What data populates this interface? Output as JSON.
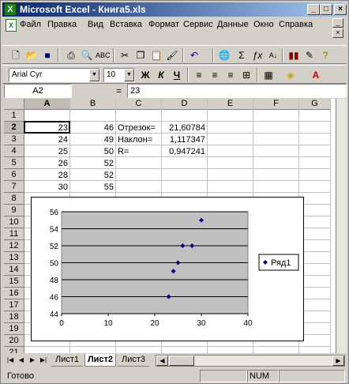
{
  "window": {
    "title": "Microsoft Excel - Книга5.xls",
    "app_icon": "excel-icon",
    "controls": [
      "_",
      "□",
      "×"
    ]
  },
  "menu": {
    "items": [
      "Файл",
      "Правка",
      "Вид",
      "Вставка",
      "Формат",
      "Сервис",
      "Данные",
      "Окно",
      "Справка"
    ],
    "doc_controls": [
      "_",
      "×"
    ]
  },
  "toolbar_standard": {
    "icons": [
      "new-icon",
      "open-icon",
      "save-icon",
      "print-icon",
      "print-preview-icon",
      "spelling-icon",
      "cut-icon",
      "copy-icon",
      "paste-icon",
      "format-painter-icon",
      "undo-icon",
      "hyperlink-icon",
      "autosum-icon",
      "function-icon",
      "sort-icon",
      "chart-wizard-icon",
      "drawing-icon",
      "help-icon"
    ]
  },
  "toolbar_format": {
    "font_name": "Arial Cyr",
    "font_size": "10",
    "bold": "Ж",
    "italic": "К",
    "underline": "Ч"
  },
  "formula_bar": {
    "name_box": "A2",
    "equals": "=",
    "value": "23"
  },
  "columns": [
    "A",
    "B",
    "C",
    "D",
    "E",
    "F",
    "G"
  ],
  "rows": [
    "1",
    "2",
    "3",
    "4",
    "5",
    "6",
    "7",
    "8",
    "9",
    "10",
    "11",
    "12",
    "13",
    "14",
    "15",
    "16",
    "17",
    "18",
    "19",
    "20",
    "21"
  ],
  "cells": {
    "A2": "23",
    "A3": "24",
    "A4": "25",
    "A5": "26",
    "A6": "28",
    "A7": "30",
    "B2": "46",
    "B3": "49",
    "B4": "50",
    "B5": "52",
    "B6": "52",
    "B7": "55",
    "C2": "Отрезок=",
    "C3": "Наклон=",
    "C4": "R=",
    "D2": "21,60784",
    "D3": "1,117347",
    "D4": "0,947241"
  },
  "chart_data": {
    "type": "scatter",
    "series": [
      {
        "name": "Ряд1",
        "x": [
          23,
          24,
          25,
          26,
          28,
          30
        ],
        "y": [
          46,
          49,
          50,
          52,
          52,
          55
        ]
      }
    ],
    "xlim": [
      0,
      40
    ],
    "ylim": [
      44,
      56
    ],
    "xticks": [
      "0",
      "10",
      "20",
      "30",
      "40"
    ],
    "yticks": [
      "44",
      "46",
      "48",
      "50",
      "52",
      "54",
      "56"
    ],
    "grid": true,
    "plot_background": "#c0c0c0",
    "marker_color": "#000080",
    "legend_position": "right",
    "title": "",
    "xlabel": "",
    "ylabel": ""
  },
  "sheet_tabs": [
    "Лист1",
    "Лист2",
    "Лист3"
  ],
  "active_tab": "Лист2",
  "status": {
    "text": "Готово",
    "num": "NUM"
  }
}
